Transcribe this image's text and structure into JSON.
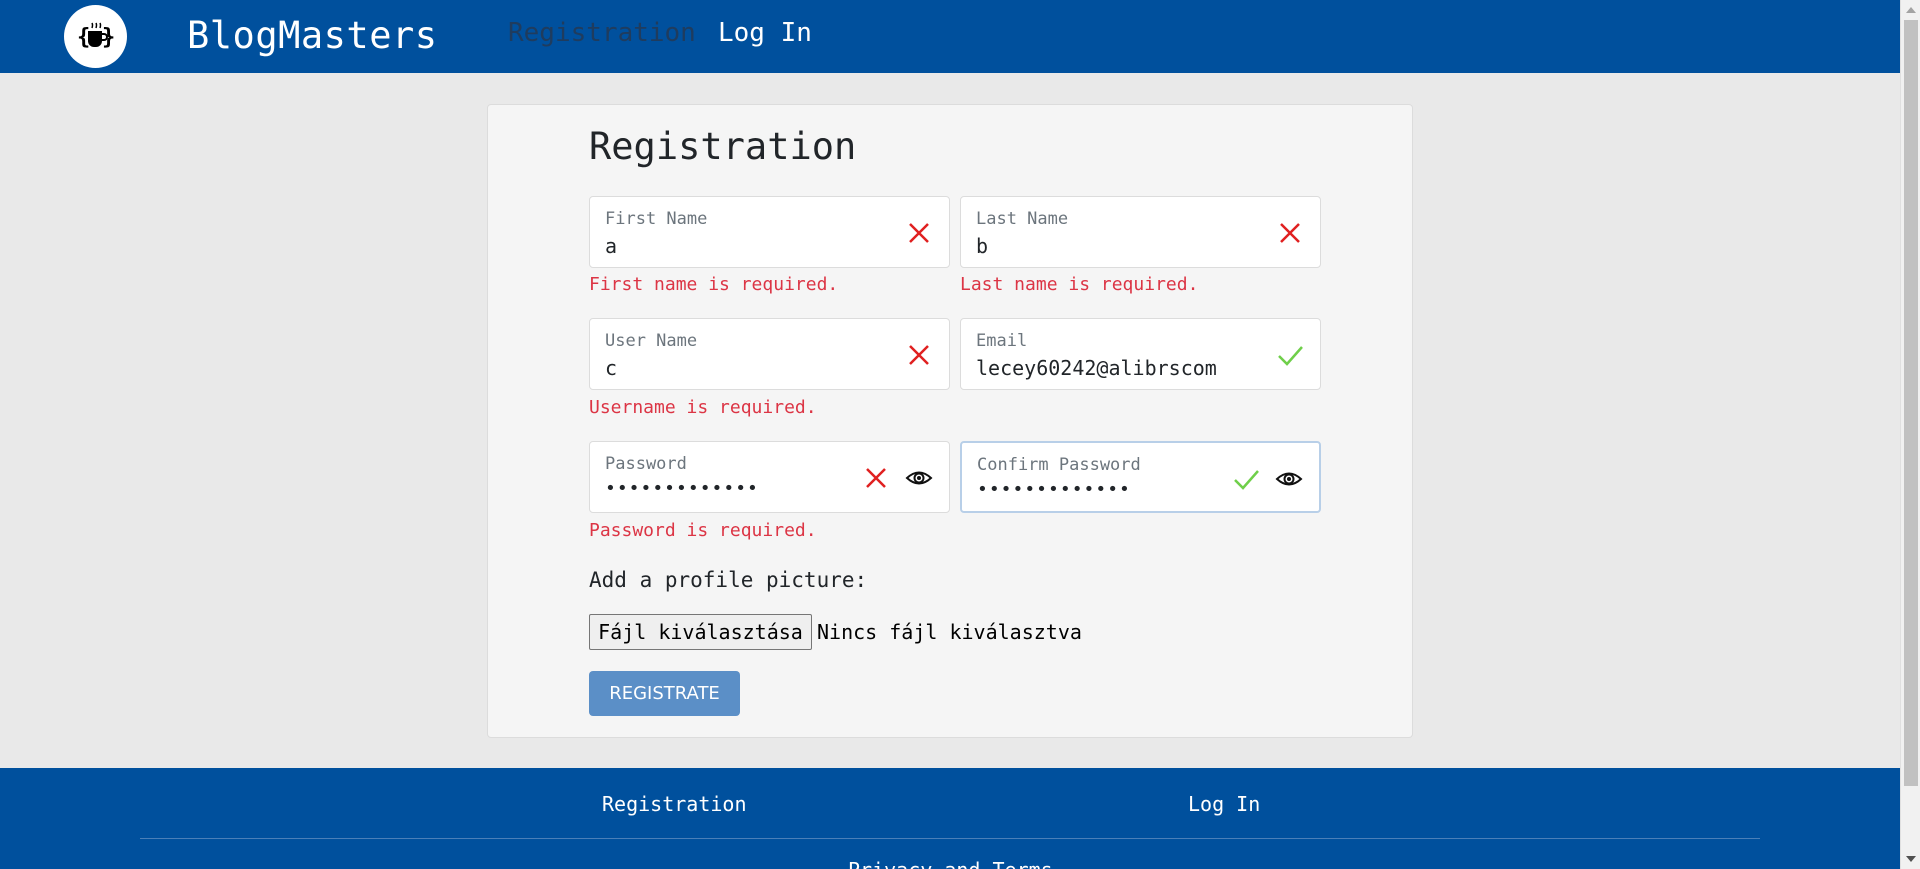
{
  "header": {
    "brand": "BlogMasters",
    "logo_icon": "coffee-cup-braces-icon",
    "nav": [
      {
        "label": "Registration",
        "active": true
      },
      {
        "label": "Log In",
        "active": false
      }
    ]
  },
  "form": {
    "title": "Registration",
    "fields": {
      "first_name": {
        "label": "First Name",
        "value": "a",
        "status": "invalid",
        "error": "First name is required."
      },
      "last_name": {
        "label": "Last Name",
        "value": "b",
        "status": "invalid",
        "error": "Last name is required."
      },
      "user_name": {
        "label": "User Name",
        "value": "c",
        "status": "invalid",
        "error": "Username is required."
      },
      "email": {
        "label": "Email",
        "value": "lecey60242@alibrscom",
        "status": "valid"
      },
      "password": {
        "label": "Password",
        "value": "•••••••••••••",
        "status": "invalid",
        "error": "Password is required."
      },
      "confirm_password": {
        "label": "Confirm Password",
        "value": "•••••••••••••",
        "status": "valid"
      }
    },
    "profile_picture_label": "Add a profile picture:",
    "file_button": "Fájl kiválasztása",
    "file_status": "Nincs fájl kiválasztva",
    "submit_label": "REGISTRATE"
  },
  "footer": {
    "links": [
      "Registration",
      "Log In"
    ],
    "bottom_text": "Privacy and Terms"
  },
  "colors": {
    "primary": "#00509d",
    "error": "#dc3545",
    "valid": "#6fcf4a",
    "button": "#5b8fc7"
  }
}
